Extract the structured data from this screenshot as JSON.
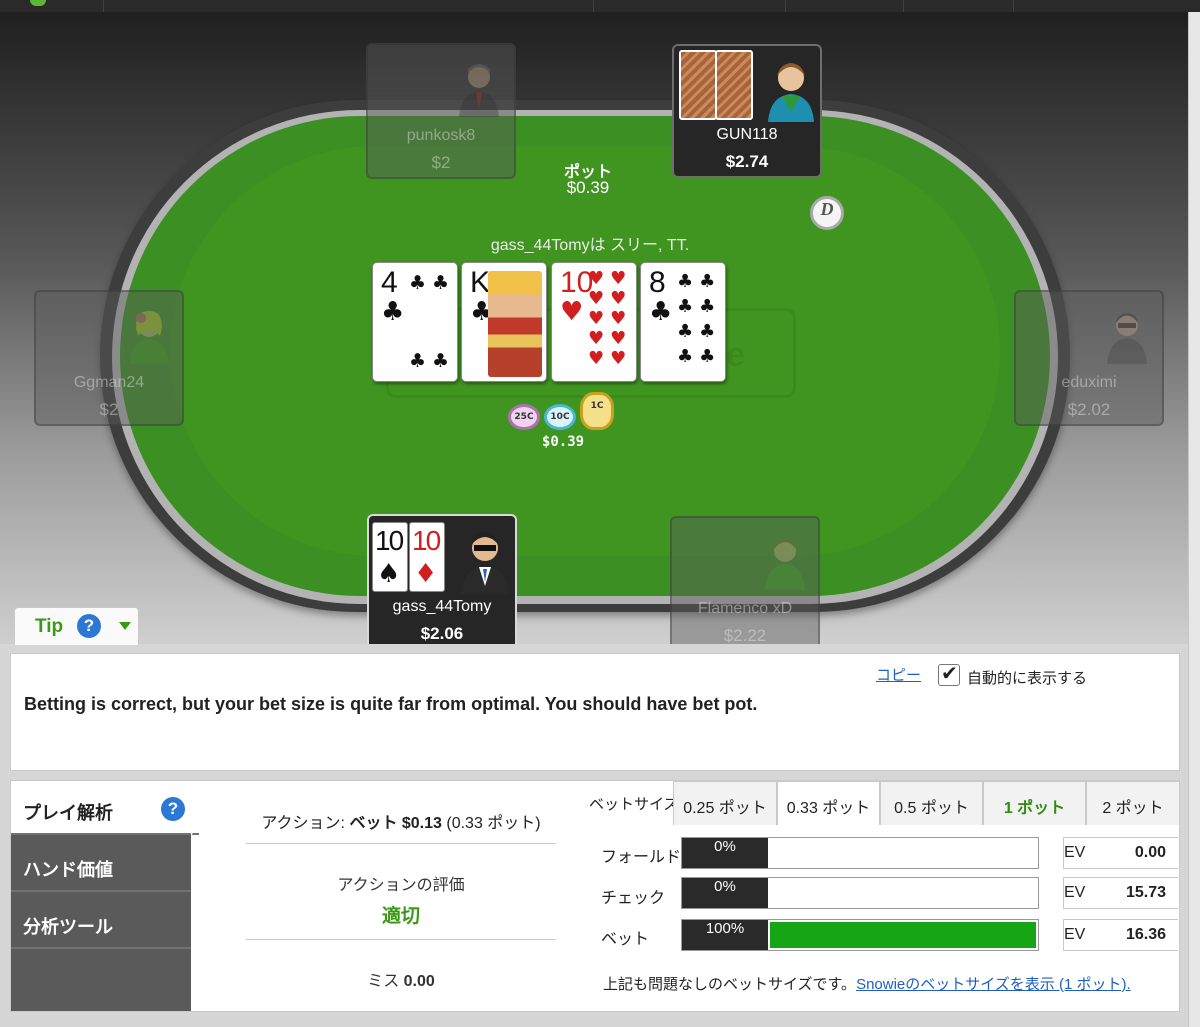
{
  "table": {
    "pot_label": "ポット",
    "pot_amount": "$0.39",
    "hand_description": "gass_44Tomyは スリー, TT.",
    "bet_chips_amount": "$0.39",
    "chip_labels": [
      "25C",
      "10C",
      "1C"
    ],
    "dealer_button": "D"
  },
  "seats": [
    {
      "name": "punkosk8",
      "stack": "$2"
    },
    {
      "name": "GUN118",
      "stack": "$2.74"
    },
    {
      "name": "Ggman24",
      "stack": "$2"
    },
    {
      "name": "eduximi",
      "stack": "$2.02"
    },
    {
      "name": "gass_44Tomy",
      "stack": "$2.06"
    },
    {
      "name": "Flamenco xD",
      "stack": "$2.22"
    }
  ],
  "board": [
    {
      "rank": "4",
      "suit": "♣",
      "color": "#111111"
    },
    {
      "rank": "K",
      "suit": "♣",
      "color": "#111111"
    },
    {
      "rank": "10",
      "suit": "♥",
      "color": "#d21e1e"
    },
    {
      "rank": "8",
      "suit": "♣",
      "color": "#111111"
    }
  ],
  "hero_cards": [
    {
      "rank": "10",
      "suit": "♠",
      "color": "#111111"
    },
    {
      "rank": "10",
      "suit": "♦",
      "color": "#d21e1e"
    }
  ],
  "tip": {
    "tab_label": "Tip",
    "message": "Betting is correct, but your bet size is quite far from optimal. You should have bet pot.",
    "copy_link": "コピー",
    "auto_show_label": "自動的に表示する",
    "auto_show_checked": true
  },
  "analysis": {
    "tabs": [
      "プレイ解析",
      "ハンド価値",
      "分析ツール"
    ],
    "action_prefix": "アクション: ",
    "action_main": "ベット $0.13",
    "action_suffix": " (0.33 ポット)",
    "eval_label": "アクションの評価",
    "eval_value": "適切",
    "miss_label": "ミス ",
    "miss_value": "0.00",
    "bet_size_label": "ベットサイズ",
    "size_tabs": [
      "0.25 ポット",
      "0.33 ポット",
      "0.5 ポット",
      "1 ポット",
      "2 ポット"
    ],
    "selected_size": "0.33 ポット",
    "best_size": "1 ポット",
    "ev_label": "EV",
    "rows": [
      {
        "label": "フォールド",
        "pct_text": "0%",
        "pct": 0,
        "ev": "0.00"
      },
      {
        "label": "チェック",
        "pct_text": "0%",
        "pct": 0,
        "ev": "15.73"
      },
      {
        "label": "ベット",
        "pct_text": "100%",
        "pct": 100,
        "ev": "16.36"
      }
    ],
    "footer_text": "上記も問題なしのベットサイズです。",
    "footer_link": "Snowieのベットサイズを表示 (1 ポット)."
  },
  "colors": {
    "felt": "#3b8f23",
    "accent_green": "#3a9a17",
    "bar_fill": "#15a515",
    "link_blue": "#1f5fc2",
    "help_icon": "#2b79d4"
  }
}
